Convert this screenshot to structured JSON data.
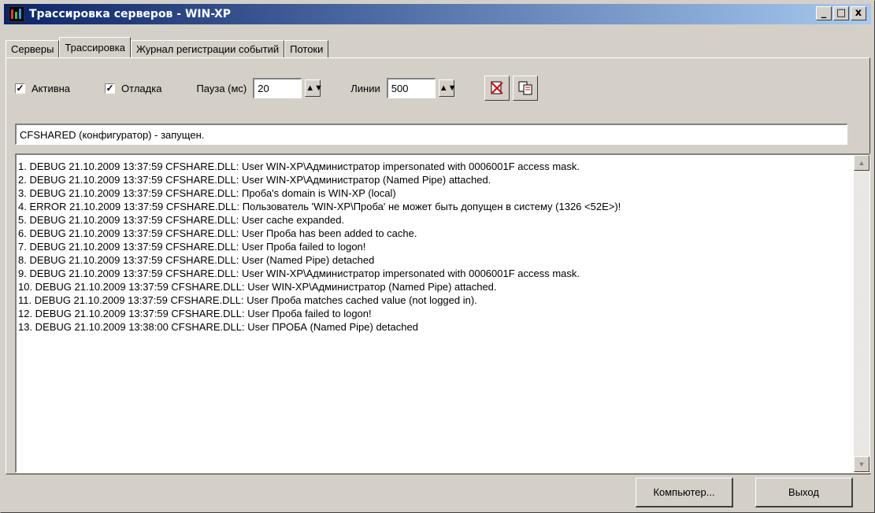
{
  "window": {
    "title": "Трассировка серверов - WIN-XP"
  },
  "tabs": [
    {
      "label": "Серверы"
    },
    {
      "label": "Трассировка"
    },
    {
      "label": "Журнал регистрации событий"
    },
    {
      "label": "Потоки"
    }
  ],
  "options": {
    "active_label": "Активна",
    "debug_label": "Отладка",
    "pause_label": "Пауза (мс)",
    "pause_value": "20",
    "lines_label": "Линии",
    "lines_value": "500"
  },
  "status_text": "CFSHARED (конфигуратор)  - запущен.",
  "log_lines": [
    "1. DEBUG  21.10.2009  13:37:59 CFSHARE.DLL: User WIN-XP\\Администратор impersonated with 0006001F access mask.",
    "2. DEBUG  21.10.2009  13:37:59 CFSHARE.DLL: User WIN-XP\\Администратор (Named Pipe) attached.",
    "3. DEBUG  21.10.2009  13:37:59 CFSHARE.DLL: Проба's domain is WIN-XP (local)",
    "4. ERROR  21.10.2009  13:37:59 CFSHARE.DLL: Пользователь 'WIN-XP\\Проба' не может быть допущен в систему (1326 <52E>)!",
    "5. DEBUG  21.10.2009  13:37:59 CFSHARE.DLL: User cache expanded.",
    "6. DEBUG  21.10.2009  13:37:59 CFSHARE.DLL: User Проба has been added to cache.",
    "7. DEBUG  21.10.2009  13:37:59 CFSHARE.DLL: User Проба failed to logon!",
    "8. DEBUG  21.10.2009  13:37:59 CFSHARE.DLL: User  (Named Pipe) detached",
    "9. DEBUG  21.10.2009  13:37:59 CFSHARE.DLL: User WIN-XP\\Администратор impersonated with 0006001F access mask.",
    "10. DEBUG  21.10.2009  13:37:59 CFSHARE.DLL: User WIN-XP\\Администратор (Named Pipe) attached.",
    "11. DEBUG  21.10.2009  13:37:59 CFSHARE.DLL: User Проба matches cached value (not logged in).",
    "12. DEBUG  21.10.2009  13:37:59 CFSHARE.DLL: User Проба failed to logon!",
    "13. DEBUG  21.10.2009  13:38:00 CFSHARE.DLL: User ПРОБА (Named Pipe) detached"
  ],
  "buttons": {
    "computer": "Компьютер...",
    "exit": "Выход"
  },
  "title_buttons": {
    "minimize": "_",
    "maximize": "□",
    "close": "x"
  },
  "icons": {
    "app": "trace-app-icon",
    "clear": "clear-log-icon",
    "copy": "copy-log-icon"
  }
}
